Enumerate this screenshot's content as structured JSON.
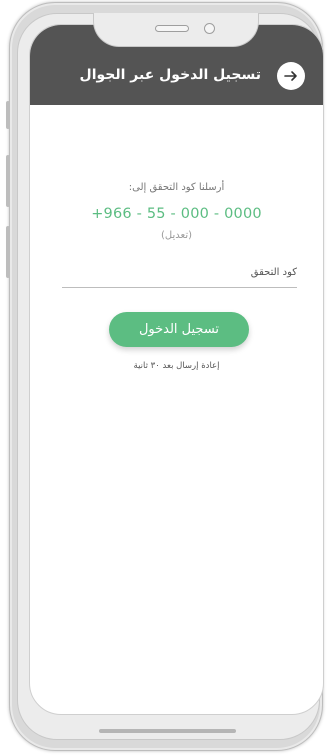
{
  "header": {
    "title": "تسجيل الدخول عبر الجوال",
    "back_icon": "arrow-right-icon"
  },
  "verification": {
    "sent_label": "أرسلنا كود التحقق إلى:",
    "phone_number": "+966 - 55 - 000 - 0000",
    "edit_label": "(تعديل)"
  },
  "code_field": {
    "placeholder": "كود التحقق",
    "value": ""
  },
  "login_button": {
    "label": "تسجيل الدخول"
  },
  "resend": {
    "text": "إعادة إرسال بعد ٣٠ ثانية"
  },
  "colors": {
    "header_bg": "#545454",
    "accent_green": "#5cbd82",
    "frame": "#d9d9d9"
  }
}
